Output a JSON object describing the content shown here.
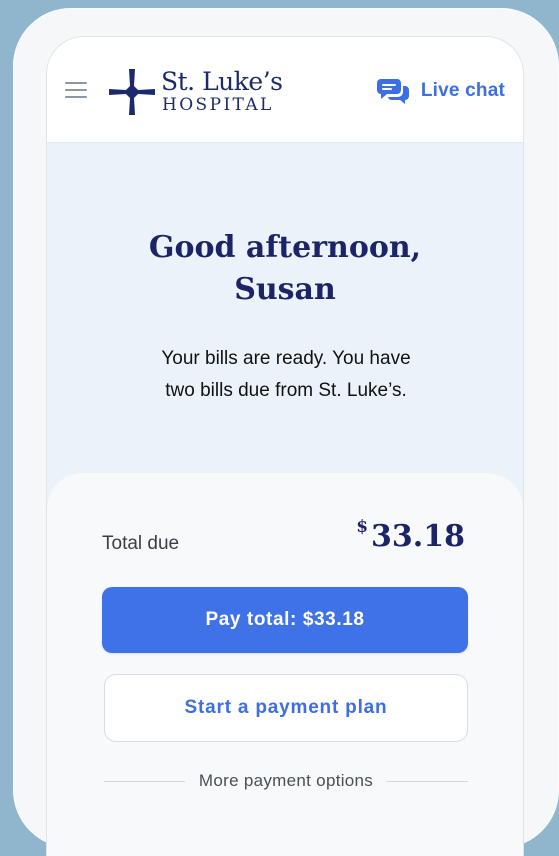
{
  "header": {
    "logo_line1": "St. Luke’s",
    "logo_line2": "HOSPITAL",
    "live_chat_label": "Live chat"
  },
  "greeting": {
    "line1": "Good afternoon,",
    "line2": "Susan"
  },
  "message": {
    "line1": "Your bills are ready. You have",
    "line2": "two bills due from St. Luke’s."
  },
  "billing": {
    "total_label": "Total due",
    "currency_symbol": "$",
    "total_amount": "33.18",
    "pay_button_label": "Pay total: $33.18",
    "payment_plan_label": "Start a payment plan",
    "more_options_label": "More payment options"
  },
  "icons": {
    "menu": "hamburger-menu-icon",
    "logo": "cross-logo-icon",
    "chat": "chat-bubbles-icon"
  },
  "colors": {
    "brand_navy": "#1c2468",
    "accent_blue": "#3f72e6",
    "background": "#ecf2fa"
  }
}
